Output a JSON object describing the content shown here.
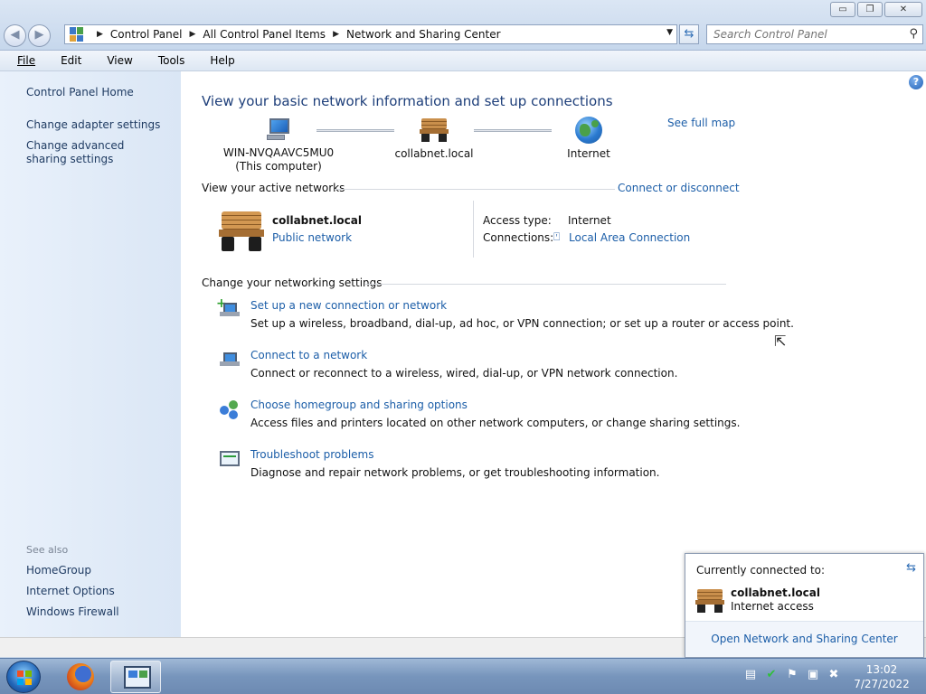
{
  "window": {
    "buttons": {
      "minimize": "▭",
      "maximize": "❐",
      "close": "✕"
    },
    "nav": {
      "back": "◀",
      "forward": "▶"
    },
    "breadcrumb": [
      "Control Panel",
      "All Control Panel Items",
      "Network and Sharing Center"
    ],
    "search_placeholder": "Search Control Panel"
  },
  "menu": {
    "items": [
      {
        "label": "File",
        "accel": "F"
      },
      {
        "label": "Edit",
        "accel": "E"
      },
      {
        "label": "View",
        "accel": "V"
      },
      {
        "label": "Tools",
        "accel": "T"
      },
      {
        "label": "Help",
        "accel": "H"
      }
    ]
  },
  "sidebar": {
    "home": "Control Panel Home",
    "links": [
      "Change adapter settings",
      "Change advanced sharing settings"
    ],
    "see_also_title": "See also",
    "see_also": [
      "HomeGroup",
      "Internet Options",
      "Windows Firewall"
    ]
  },
  "main": {
    "heading": "View your basic network information and set up connections",
    "see_full_map": "See full map",
    "map": {
      "computer_name": "WIN-NVQAAVC5MU0",
      "computer_sub": "(This computer)",
      "network_name": "collabnet.local",
      "internet": "Internet"
    },
    "active_title": "View your active networks",
    "connect_or_disconnect": "Connect or disconnect",
    "active": {
      "name": "collabnet.local",
      "type": "Public network",
      "access_label": "Access type:",
      "access_value": "Internet",
      "connections_label": "Connections:",
      "connections_value": "Local Area Connection"
    },
    "settings_title": "Change your networking settings",
    "tasks": [
      {
        "link": "Set up a new connection or network",
        "desc": "Set up a wireless, broadband, dial-up, ad hoc, or VPN connection; or set up a router or access point."
      },
      {
        "link": "Connect to a network",
        "desc": "Connect or reconnect to a wireless, wired, dial-up, or VPN network connection."
      },
      {
        "link": "Choose homegroup and sharing options",
        "desc": "Access files and printers located on other network computers, or change sharing settings."
      },
      {
        "link": "Troubleshoot problems",
        "desc": "Diagnose and repair network problems, or get troubleshooting information."
      }
    ]
  },
  "popup": {
    "title": "Currently connected to:",
    "network": "collabnet.local",
    "status": "Internet access",
    "footer_link": "Open Network and Sharing Center"
  },
  "taskbar": {
    "time": "13:02",
    "date": "7/27/2022"
  },
  "colors": {
    "link": "#1c5ea8",
    "heading": "#1e3f7a",
    "sidebar_bg": "#dae6f5"
  }
}
